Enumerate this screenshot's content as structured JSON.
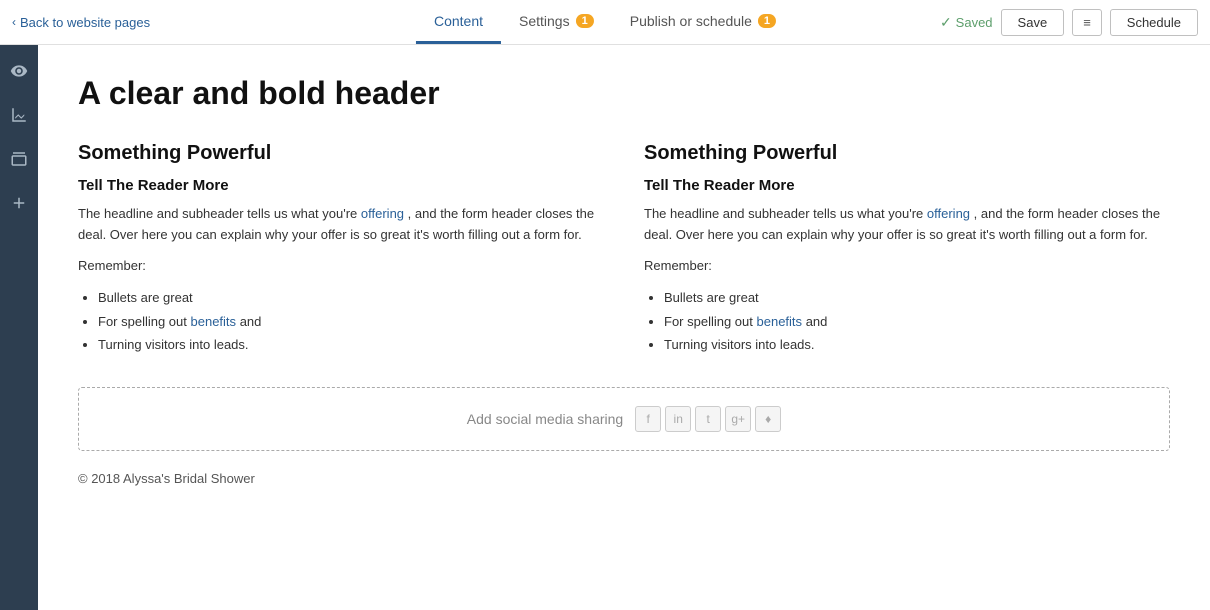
{
  "topbar": {
    "back_label": "Back to website pages",
    "chevron": "‹",
    "tabs": [
      {
        "id": "content",
        "label": "Content",
        "badge": null,
        "active": true
      },
      {
        "id": "settings",
        "label": "Settings",
        "badge": "1",
        "active": false
      },
      {
        "id": "publish",
        "label": "Publish or schedule",
        "badge": "1",
        "active": false
      }
    ],
    "saved_label": "Saved",
    "save_button": "Save",
    "schedule_button": "Schedule",
    "more_icon": "≡"
  },
  "sidebar": {
    "icons": [
      {
        "name": "eye-icon",
        "symbol": "👁",
        "label": "Preview"
      },
      {
        "name": "chart-icon",
        "symbol": "📊",
        "label": "Analytics"
      },
      {
        "name": "box-icon",
        "symbol": "⬜",
        "label": "Modules"
      },
      {
        "name": "plus-icon",
        "symbol": "+",
        "label": "Add"
      }
    ]
  },
  "content": {
    "page_title": "A clear and bold header",
    "left_col": {
      "heading": "Something Powerful",
      "subheading": "Tell The Reader More",
      "body1": "The headline and subheader tells us what you're",
      "link1": "offering",
      "body1_cont": ", and the form header closes the deal. Over here you can explain why your offer is so great it's worth filling out a form for.",
      "remember": "Remember:",
      "bullets": [
        "Bullets are great",
        "For spelling out",
        "Turning visitors into leads."
      ],
      "bullet2_link": "benefits",
      "bullet2_after": " and"
    },
    "right_col": {
      "heading": "Something Powerful",
      "subheading": "Tell The Reader More",
      "body1": "The headline and subheader tells us what you're",
      "link1": "offering",
      "body1_cont": ", and the form header closes the deal. Over here you can explain why your offer is so great it's worth filling out a form for.",
      "remember": "Remember:",
      "bullets": [
        "Bullets are great",
        "For spelling out",
        "Turning visitors into leads."
      ],
      "bullet2_link": "benefits",
      "bullet2_after": " and"
    },
    "social_block": {
      "label": "Add social media sharing",
      "icons": [
        "f",
        "in",
        "t",
        "g+",
        "♦"
      ]
    },
    "footer": "© 2018 Alyssa's Bridal Shower"
  }
}
